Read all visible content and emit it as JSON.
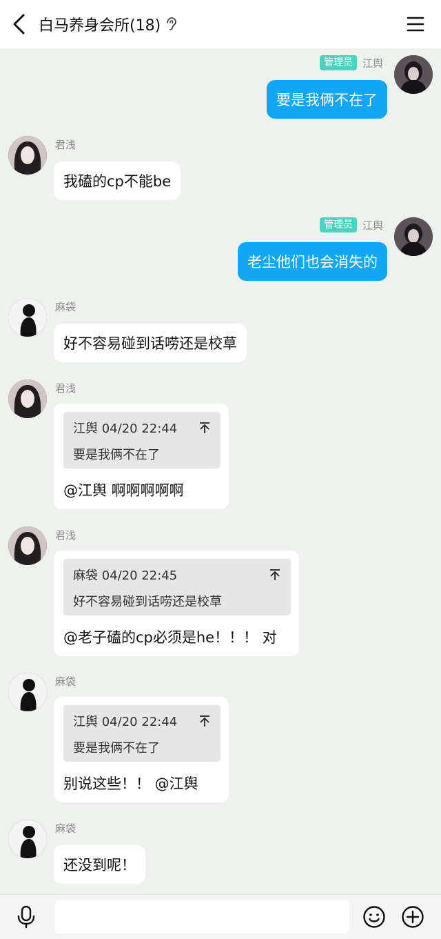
{
  "header": {
    "title": "白马养身会所(18)",
    "back_icon": "chevron-left-icon",
    "ear_icon": "ear-icon",
    "menu_icon": "hamburger-menu-icon"
  },
  "colors": {
    "background": "#eef1ee",
    "bubble_out": "#12a6f5",
    "bubble_in": "#ffffff",
    "badge": "#4fd1c2"
  },
  "messages": [
    {
      "sender": "江舆",
      "badge": "管理员",
      "text": "要是我俩不在了",
      "direction": "out"
    },
    {
      "sender": "君浅",
      "text": "我磕的cp不能be",
      "direction": "in"
    },
    {
      "sender": "江舆",
      "badge": "管理员",
      "text": "老尘他们也会消失的",
      "direction": "out"
    },
    {
      "sender": "麻袋",
      "text": "好不容易碰到话唠还是校草",
      "direction": "in"
    },
    {
      "sender": "君浅",
      "direction": "in",
      "quote": {
        "head": "江舆 04/20 22:44",
        "body": "要是我俩不在了"
      },
      "text": "@江舆 啊啊啊啊啊"
    },
    {
      "sender": "君浅",
      "direction": "in",
      "quote": {
        "head": "麻袋 04/20 22:45",
        "body": "好不容易碰到话唠还是校草"
      },
      "text": "@老子磕的cp必须是he！！！ 对"
    },
    {
      "sender": "麻袋",
      "direction": "in",
      "quote": {
        "head": "江舆 04/20 22:44",
        "body": "要是我俩不在了"
      },
      "text": "别说这些！！ @江舆"
    },
    {
      "sender": "麻袋",
      "text": "还没到呢！",
      "direction": "in"
    }
  ],
  "input": {
    "value": "",
    "placeholder": ""
  },
  "toolbar": {
    "mic_icon": "microphone-icon",
    "emoji_icon": "emoji-icon",
    "plus_icon": "plus-circle-icon"
  }
}
